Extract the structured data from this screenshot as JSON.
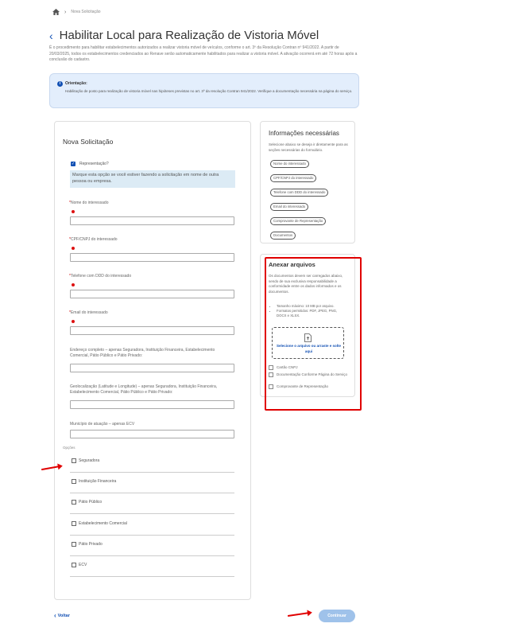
{
  "breadcrumb": {
    "current": "Nova Solicitação"
  },
  "header": {
    "title": "Habilitar Local para Realização de Vistoria Móvel",
    "intro": "É o procedimento para habilitar estabelecimentos autorizados a realizar vistoria móvel de veículos, conforme o art. 3º da Resolução Contran nº 941/2022. A partir de 20/03/2025, todos os estabelecimentos credenciados ao Renave serão automaticamente habilitados para realizar a vistoria móvel. A ativação ocorrerá em até 72 horas após a conclusão do cadastro."
  },
  "orientation": {
    "heading": "Orientação:",
    "text": "Habilitação de posto para realização de vistoria móvel nas hipóteses previstas no art. 3º da resolução Contran 941/2022. Verifique a documentação necessária na página do serviço."
  },
  "form": {
    "title": "Nova Solicitação",
    "representation_label": "Representação?",
    "representation_hint": "Marque esta opção se você estiver fazendo a solicitação em nome de outra pessoa ou empresa.",
    "required_mark": "*",
    "fields": [
      {
        "label": "Nome do interessado"
      },
      {
        "label": "CPF/CNPJ do interessado"
      },
      {
        "label": "Telefone com DDD do interessado"
      },
      {
        "label": "Email do interessado"
      }
    ],
    "address_label": "Endereço completo – apenas Seguradora, Instituição Financeira, Estabelecimento Comercial, Pátio Público e Pátio Privado:",
    "geo_label": "Geolocalização (Latitude e Longitude) – apenas Seguradora, Instituição Financeira, Estabelecimento Comercial, Pátio Público e Pátio Privado:",
    "city_label": "Município de atuação – apenas ECV",
    "options_label": "Opções",
    "options": [
      {
        "label": "Seguradora"
      },
      {
        "label": "Instituição Financeira"
      },
      {
        "label": "Pátio Público"
      },
      {
        "label": "Estabelecimento Comercial"
      },
      {
        "label": "Pátio Privado"
      },
      {
        "label": "ECV"
      }
    ]
  },
  "info_panel": {
    "title": "Informações necessárias",
    "description": "Selecione abaixo se deseja ir diretamente para as seções necessárias do formulário.",
    "chips": [
      "Nome do interessado",
      "CPF/CNPJ do interessado",
      "Telefone com DDD do interessado",
      "Email do interessado",
      "Comprovante de Representação",
      "Documentos"
    ]
  },
  "attachments": {
    "title": "Anexar arquivos",
    "description": "Os documentos devem ser carregados abaixo, sendo de sua exclusiva responsabilidade a conformidade entre os dados informados e os documentos.",
    "rules": [
      "Tamanho máximo: 10 MB por arquivo.",
      "Formatos permitidos: PDF, JPEG, PNG, DOCX e XLSX."
    ],
    "dropzone_text": "Selecione o arquivo ou arraste e solte aqui",
    "documents": [
      "Cartão CNPJ",
      "Documentação Conforme Página do Serviço",
      "Comprovante de Representação"
    ]
  },
  "footer": {
    "back_label": "Voltar",
    "continue_label": "Continuar"
  },
  "colors": {
    "primary": "#1351b4",
    "annotation_red": "#e00000",
    "continue_disabled": "#9fc2ea",
    "info_bg": "#e3eefc"
  }
}
